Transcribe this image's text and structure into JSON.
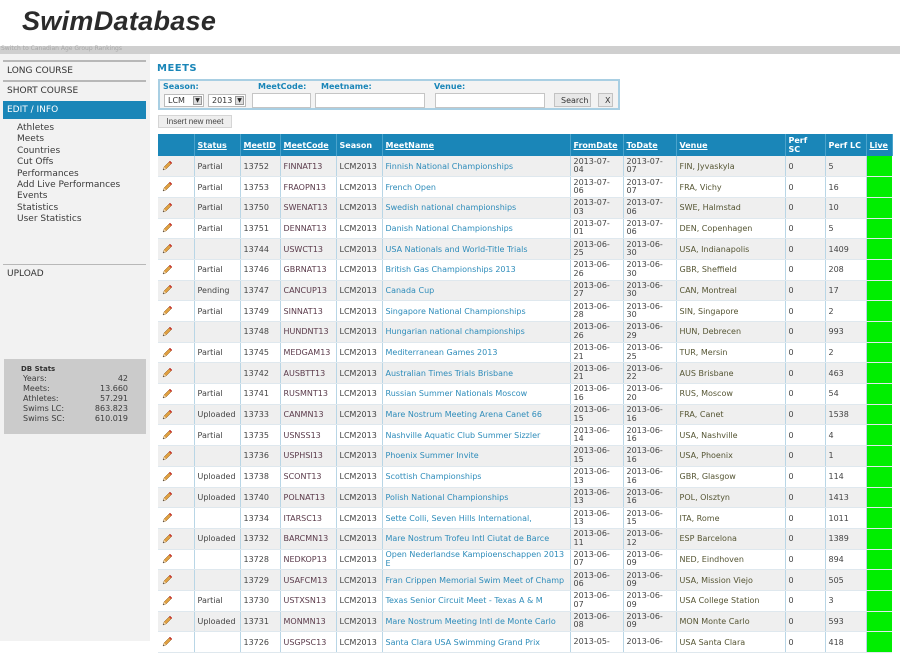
{
  "app": {
    "logo": "SwimDatabase",
    "switch_link": "Switch to Canadian Age Group Rankings"
  },
  "sidebar": {
    "sections": [
      {
        "label": "LONG COURSE"
      },
      {
        "label": "SHORT COURSE"
      }
    ],
    "active_section": "EDIT / INFO",
    "sub_items": [
      {
        "label": "Athletes"
      },
      {
        "label": "Meets"
      },
      {
        "label": "Countries"
      },
      {
        "label": "Cut Offs"
      },
      {
        "label": "Performances"
      },
      {
        "label": "Add Live Performances"
      },
      {
        "label": "Events"
      },
      {
        "label": "Statistics"
      },
      {
        "label": "User Statistics"
      }
    ],
    "upload_label": "UPLOAD",
    "stats": {
      "title": "DB Stats",
      "rows": [
        {
          "label": "Years:",
          "value": "42"
        },
        {
          "label": "Meets:",
          "value": "13.660"
        },
        {
          "label": "Athletes:",
          "value": "57.291"
        },
        {
          "label": "Swims LC:",
          "value": "863.823"
        },
        {
          "label": "Swims SC:",
          "value": "610.019"
        }
      ]
    }
  },
  "main": {
    "title": "MEETS",
    "search": {
      "season_label": "Season:",
      "meetcode_label": "MeetCode:",
      "meetname_label": "Meetname:",
      "venue_label": "Venue:",
      "course_value": "LCM",
      "year_value": "2013",
      "meetcode_value": "",
      "meetname_value": "",
      "venue_value": "",
      "search_button": "Search",
      "clear_button": "X"
    },
    "insert_button": "Insert new meet",
    "table": {
      "headers": {
        "status": "Status",
        "meetid": "MeetID",
        "meetcode": "MeetCode",
        "season": "Season",
        "meetname": "MeetName",
        "fromdate": "FromDate",
        "todate": "ToDate",
        "venue": "Venue",
        "perfsc": "Perf SC",
        "perflc": "Perf LC",
        "live": "Live"
      },
      "live_color": "#00ee00",
      "rows": [
        {
          "status": "Partial",
          "id": "13752",
          "code": "FINNAT13",
          "season": "LCM2013",
          "name": "Finnish National Championships",
          "from": "2013-07-04",
          "to": "2013-07-07",
          "venue": "FIN, Jyvaskyla",
          "sc": "0",
          "lc": "5"
        },
        {
          "status": "Partial",
          "id": "13753",
          "code": "FRAOPN13",
          "season": "LCM2013",
          "name": "French Open",
          "from": "2013-07-06",
          "to": "2013-07-07",
          "venue": "FRA, Vichy",
          "sc": "0",
          "lc": "16"
        },
        {
          "status": "Partial",
          "id": "13750",
          "code": "SWENAT13",
          "season": "LCM2013",
          "name": "Swedish national championships",
          "from": "2013-07-03",
          "to": "2013-07-06",
          "venue": "SWE, Halmstad",
          "sc": "0",
          "lc": "10"
        },
        {
          "status": "Partial",
          "id": "13751",
          "code": "DENNAT13",
          "season": "LCM2013",
          "name": "Danish National Championships",
          "from": "2013-07-01",
          "to": "2013-07-06",
          "venue": "DEN, Copenhagen",
          "sc": "0",
          "lc": "5"
        },
        {
          "status": "",
          "id": "13744",
          "code": "USWCT13",
          "season": "LCM2013",
          "name": "USA Nationals and World-Title Trials",
          "from": "2013-06-25",
          "to": "2013-06-30",
          "venue": "USA, Indianapolis",
          "sc": "0",
          "lc": "1409"
        },
        {
          "status": "Partial",
          "id": "13746",
          "code": "GBRNAT13",
          "season": "LCM2013",
          "name": "British Gas Championships 2013",
          "from": "2013-06-26",
          "to": "2013-06-30",
          "venue": "GBR, Sheffield",
          "sc": "0",
          "lc": "208"
        },
        {
          "status": "Pending",
          "id": "13747",
          "code": "CANCUP13",
          "season": "LCM2013",
          "name": "Canada Cup",
          "from": "2013-06-27",
          "to": "2013-06-30",
          "venue": "CAN, Montreal",
          "sc": "0",
          "lc": "17"
        },
        {
          "status": "Partial",
          "id": "13749",
          "code": "SINNAT13",
          "season": "LCM2013",
          "name": "Singapore National Championships",
          "from": "2013-06-28",
          "to": "2013-06-30",
          "venue": "SIN, Singapore",
          "sc": "0",
          "lc": "2"
        },
        {
          "status": "",
          "id": "13748",
          "code": "HUNDNT13",
          "season": "LCM2013",
          "name": "Hungarian national championships",
          "from": "2013-06-26",
          "to": "2013-06-29",
          "venue": "HUN, Debrecen",
          "sc": "0",
          "lc": "993"
        },
        {
          "status": "Partial",
          "id": "13745",
          "code": "MEDGAM13",
          "season": "LCM2013",
          "name": "Mediterranean Games 2013",
          "from": "2013-06-21",
          "to": "2013-06-25",
          "venue": "TUR, Mersin",
          "sc": "0",
          "lc": "2"
        },
        {
          "status": "",
          "id": "13742",
          "code": "AUSBTT13",
          "season": "LCM2013",
          "name": "Australian Times Trials Brisbane",
          "from": "2013-06-21",
          "to": "2013-06-22",
          "venue": "AUS Brisbane",
          "sc": "0",
          "lc": "463"
        },
        {
          "status": "Partial",
          "id": "13741",
          "code": "RUSMNT13",
          "season": "LCM2013",
          "name": "Russian Summer Nationals Moscow",
          "from": "2013-06-16",
          "to": "2013-06-20",
          "venue": "RUS, Moscow",
          "sc": "0",
          "lc": "54"
        },
        {
          "status": "Uploaded",
          "id": "13733",
          "code": "CANMN13",
          "season": "LCM2013",
          "name": "Mare Nostrum Meeting Arena Canet 66",
          "from": "2013-06-15",
          "to": "2013-06-16",
          "venue": "FRA, Canet",
          "sc": "0",
          "lc": "1538"
        },
        {
          "status": "Partial",
          "id": "13735",
          "code": "USNSS13",
          "season": "LCM2013",
          "name": "Nashville Aquatic Club Summer Sizzler",
          "from": "2013-06-14",
          "to": "2013-06-16",
          "venue": "USA, Nashville",
          "sc": "0",
          "lc": "4"
        },
        {
          "status": "",
          "id": "13736",
          "code": "USPHSI13",
          "season": "LCM2013",
          "name": "Phoenix Summer Invite",
          "from": "2013-06-15",
          "to": "2013-06-16",
          "venue": "USA, Phoenix",
          "sc": "0",
          "lc": "1"
        },
        {
          "status": "Uploaded",
          "id": "13738",
          "code": "SCONT13",
          "season": "LCM2013",
          "name": "Scottish Championships",
          "from": "2013-06-13",
          "to": "2013-06-16",
          "venue": "GBR, Glasgow",
          "sc": "0",
          "lc": "114"
        },
        {
          "status": "Uploaded",
          "id": "13740",
          "code": "POLNAT13",
          "season": "LCM2013",
          "name": "Polish National Championships",
          "from": "2013-06-13",
          "to": "2013-06-16",
          "venue": "POL, Olsztyn",
          "sc": "0",
          "lc": "1413"
        },
        {
          "status": "",
          "id": "13734",
          "code": "ITARSC13",
          "season": "LCM2013",
          "name": "Sette Colli, Seven Hills International,",
          "from": "2013-06-13",
          "to": "2013-06-15",
          "venue": "ITA, Rome",
          "sc": "0",
          "lc": "1011"
        },
        {
          "status": "Uploaded",
          "id": "13732",
          "code": "BARCMN13",
          "season": "LCM2013",
          "name": "Mare Nostrum Trofeu Intl Ciutat de Barce",
          "from": "2013-06-11",
          "to": "2013-06-12",
          "venue": "ESP Barcelona",
          "sc": "0",
          "lc": "1389"
        },
        {
          "status": "",
          "id": "13728",
          "code": "NEDKOP13",
          "season": "LCM2013",
          "name": "Open Nederlandse Kampioenschappen 2013 E",
          "from": "2013-06-07",
          "to": "2013-06-09",
          "venue": "NED, Eindhoven",
          "sc": "0",
          "lc": "894"
        },
        {
          "status": "",
          "id": "13729",
          "code": "USAFCM13",
          "season": "LCM2013",
          "name": "Fran Crippen Memorial Swim Meet of Champ",
          "from": "2013-06-06",
          "to": "2013-06-09",
          "venue": "USA, Mission Viejo",
          "sc": "0",
          "lc": "505"
        },
        {
          "status": "Partial",
          "id": "13730",
          "code": "USTXSN13",
          "season": "LCM2013",
          "name": "Texas Senior Circuit Meet - Texas A & M",
          "from": "2013-06-07",
          "to": "2013-06-09",
          "venue": "USA College Station",
          "sc": "0",
          "lc": "3"
        },
        {
          "status": "Uploaded",
          "id": "13731",
          "code": "MONMN13",
          "season": "LCM2013",
          "name": "Mare Nostrum Meeting Intl de Monte Carlo",
          "from": "2013-06-08",
          "to": "2013-06-09",
          "venue": "MON Monte Carlo",
          "sc": "0",
          "lc": "593"
        },
        {
          "status": "",
          "id": "13726",
          "code": "USGPSC13",
          "season": "LCM2013",
          "name": "Santa Clara USA Swimming Grand Prix",
          "from": "2013-05-",
          "to": "2013-06-",
          "venue": "USA Santa Clara",
          "sc": "0",
          "lc": "418"
        }
      ]
    }
  }
}
